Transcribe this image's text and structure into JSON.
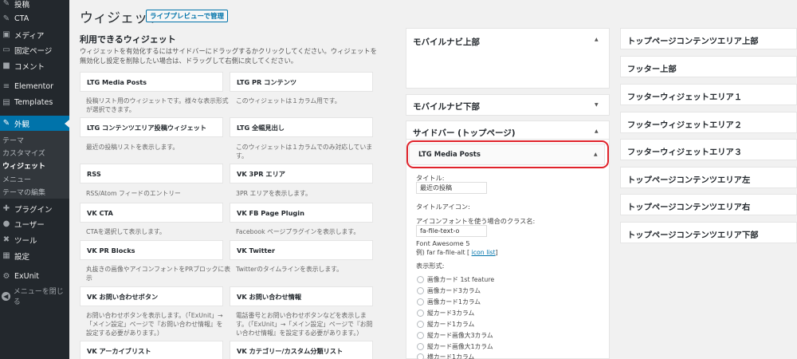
{
  "sidebar": {
    "items": [
      {
        "label": "投稿",
        "icon": "pin-icon",
        "glyph": "✎"
      },
      {
        "label": "CTA",
        "icon": "pin-icon",
        "glyph": "✎"
      },
      {
        "label": "メディア",
        "icon": "media-icon",
        "glyph": "▣"
      },
      {
        "label": "固定ページ",
        "icon": "page-icon",
        "glyph": "▭"
      },
      {
        "label": "コメント",
        "icon": "comment-icon",
        "glyph": "■"
      },
      {
        "label": "Elementor",
        "icon": "elementor-icon",
        "glyph": "≡"
      },
      {
        "label": "Templates",
        "icon": "templates-icon",
        "glyph": "▤"
      },
      {
        "label": "外観",
        "icon": "appearance-icon",
        "glyph": "✎"
      },
      {
        "label": "プラグイン",
        "icon": "plugin-icon",
        "glyph": "✚"
      },
      {
        "label": "ユーザー",
        "icon": "user-icon",
        "glyph": "●"
      },
      {
        "label": "ツール",
        "icon": "tool-icon",
        "glyph": "✖"
      },
      {
        "label": "設定",
        "icon": "settings-icon",
        "glyph": "▦"
      },
      {
        "label": "ExUnit",
        "icon": "exunit-icon",
        "glyph": "⚙"
      }
    ],
    "submenu": [
      "テーマ",
      "カスタマイズ",
      "ウィジェット",
      "メニュー",
      "テーマの編集"
    ],
    "collapse": "メニューを閉じる"
  },
  "header": {
    "title": "ウィジェット",
    "live_preview": "ライブプレビューで管理"
  },
  "available": {
    "title": "利用できるウィジェット",
    "description": "ウィジェットを有効化するにはサイドバーにドラッグするかクリックしてください。ウィジェットを無効化し設定を削除したい場合は、ドラッグして右側に戻してください。",
    "widgets": [
      {
        "name": "LTG Media Posts",
        "desc": "投稿リスト用のウィジェットです。様々な表示形式が選択できます。"
      },
      {
        "name": "LTG PR コンテンツ",
        "desc": "このウィジェットは１カラム用です。"
      },
      {
        "name": "LTG コンテンツエリア投稿ウィジェット",
        "desc": "最近の投稿リストを表示します。"
      },
      {
        "name": "LTG 全幅見出し",
        "desc": "このウィジェットは１カラムでのみ対応しています。"
      },
      {
        "name": "RSS",
        "desc": "RSS/Atom フィードのエントリー"
      },
      {
        "name": "VK 3PR エリア",
        "desc": "3PR エリアを表示します。"
      },
      {
        "name": "VK CTA",
        "desc": "CTAを選択して表示します。"
      },
      {
        "name": "VK FB Page Plugin",
        "desc": "Facebook ページプラグインを表示します。"
      },
      {
        "name": "VK PR Blocks",
        "desc": "丸抜きの画像やアイコンフォントをPRブロックに表示"
      },
      {
        "name": "VK Twitter",
        "desc": "Twitterのタイムラインを表示します。"
      },
      {
        "name": "VK お問い合わせボタン",
        "desc": "お問い合わせボタンを表示します。（「ExUnit」→「メイン設定」ページで『お問い合わせ情報』を設定する必要があります。）"
      },
      {
        "name": "VK お問い合わせ情報",
        "desc": "電話番号とお問い合わせボタンなどを表示します。（「ExUnit」→「メイン設定」ページで『お問い合わせ情報』を設定する必要があります。）"
      },
      {
        "name": "VK アーカイブリスト",
        "desc": ""
      },
      {
        "name": "VK カテゴリー/カスタム分類リスト",
        "desc": ""
      }
    ]
  },
  "areas_middle": {
    "mobile_nav_top": "モバイルナビ上部",
    "mobile_nav_bottom": "モバイルナビ下部",
    "sidebar_top": "サイドバー (トップページ)"
  },
  "ltg_widget": {
    "title": "LTG Media Posts",
    "title_label": "タイトル:",
    "title_value": "最近の投稿",
    "icon_label": "タイトルアイコン:",
    "icon_class_label": "アイコンフォントを使う場合のクラス名:",
    "icon_class_value": "fa-file-text-o",
    "fa_version": "Font Awesome 5",
    "example": "例) far fa-file-alt [",
    "icon_list": "icon list",
    "example_end": "]",
    "display_label": "表示形式:",
    "options": [
      "画像カード 1st feature",
      "画像カード3カラム",
      "画像カード1カラム",
      "縦カード3カラム",
      "縦カード1カラム",
      "縦カード画像大3カラム",
      "縦カード画像大1カラム",
      "横カード1カラム"
    ]
  },
  "areas_right": [
    "トップページコンテンツエリア上部",
    "フッター上部",
    "フッターウィジェットエリア１",
    "フッターウィジェットエリア２",
    "フッターウィジェットエリア３",
    "トップページコンテンツエリア左",
    "トップページコンテンツエリア右",
    "トップページコンテンツエリア下部"
  ],
  "colors": {
    "accent": "#0073aa",
    "sidebar_bg": "#23282d",
    "highlight": "#e0232b"
  }
}
